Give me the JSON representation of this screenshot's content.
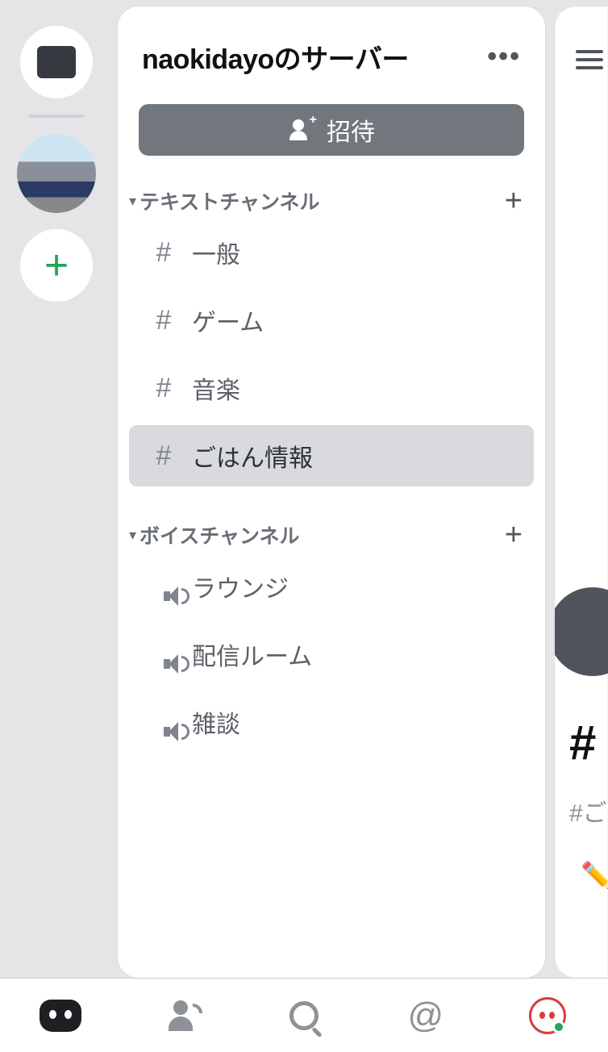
{
  "server": {
    "title": "naokidayoのサーバー",
    "invite_label": "招待"
  },
  "sections": {
    "text": {
      "label": "テキストチャンネル"
    },
    "voice": {
      "label": "ボイスチャンネル"
    }
  },
  "text_channels": [
    {
      "name": "一般",
      "active": false
    },
    {
      "name": "ゲーム",
      "active": false
    },
    {
      "name": "音楽",
      "active": false
    },
    {
      "name": "ごはん情報",
      "active": true
    }
  ],
  "voice_channels": [
    {
      "name": "ラウンジ"
    },
    {
      "name": "配信ルーム"
    },
    {
      "name": "雑談"
    }
  ],
  "right_panel": {
    "hash": "#",
    "channel_prefix": "#ご"
  }
}
